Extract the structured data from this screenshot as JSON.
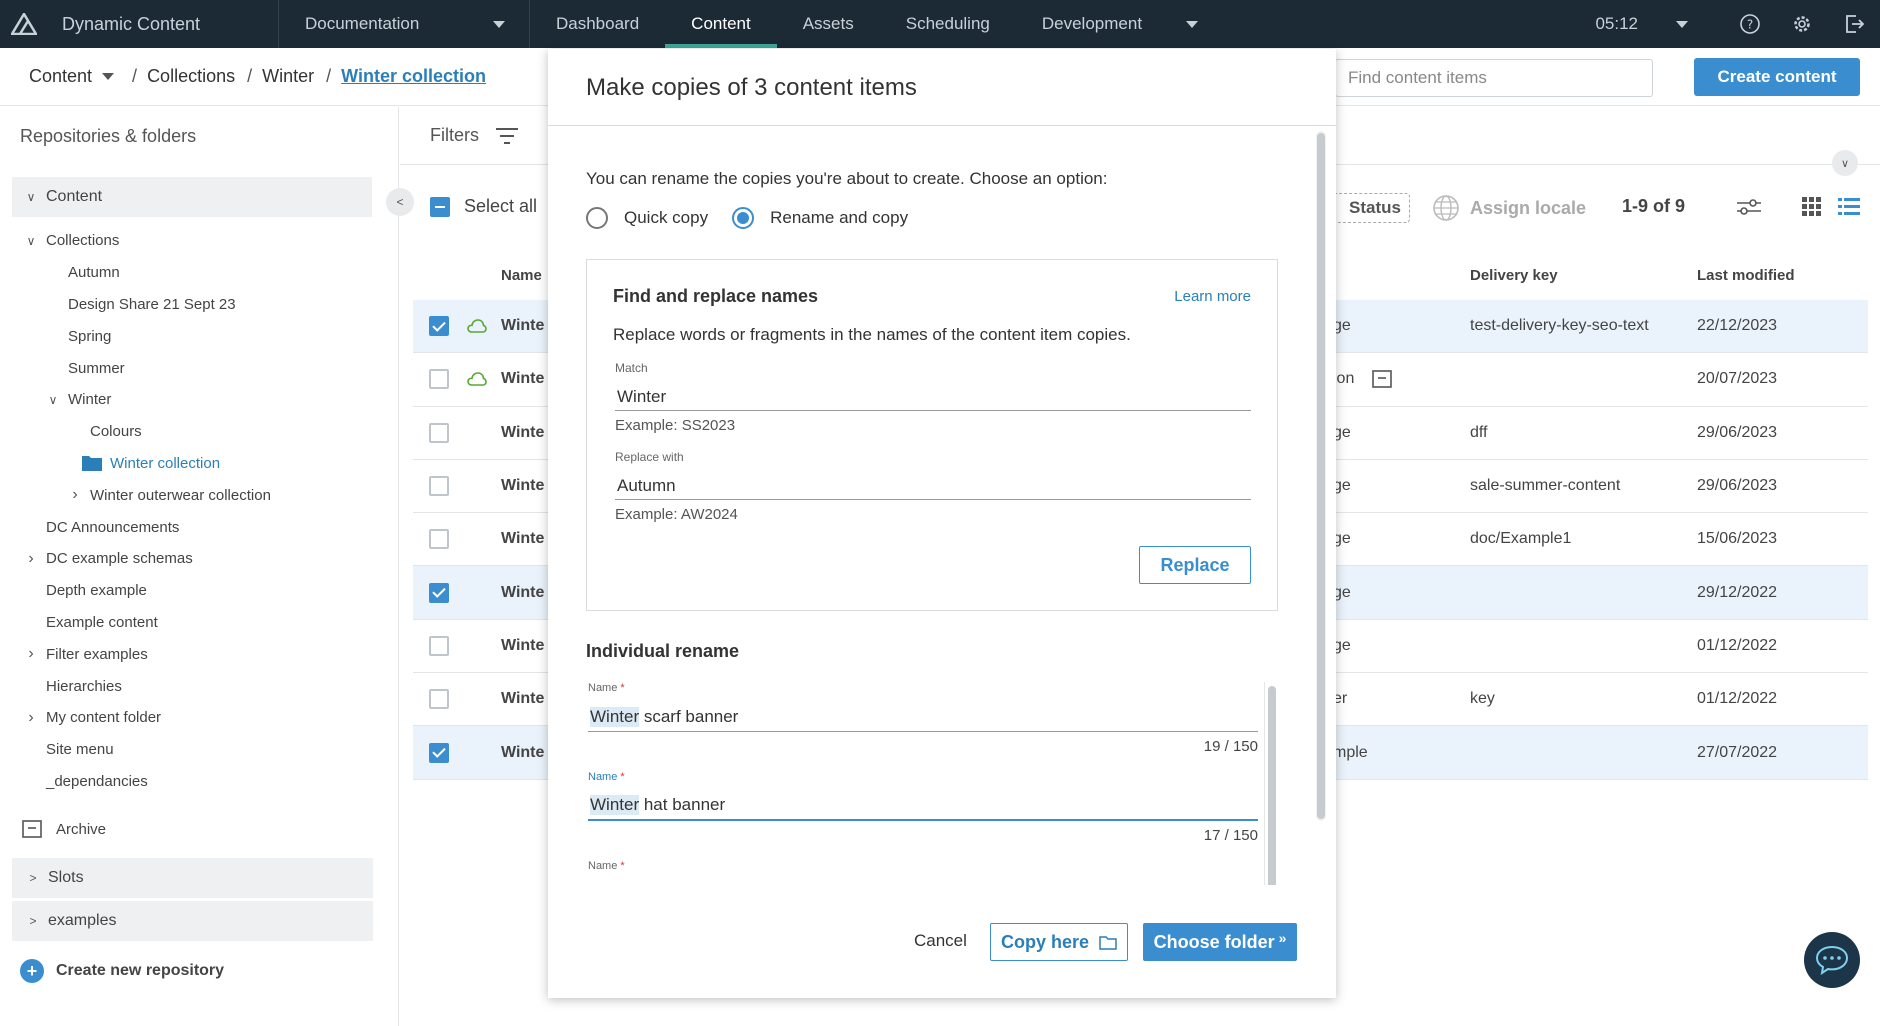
{
  "nav": {
    "app_title": "Dynamic Content",
    "hub": "Documentation",
    "tabs": [
      "Dashboard",
      "Content",
      "Assets",
      "Scheduling",
      "Development"
    ],
    "clock": "05:12"
  },
  "breadcrumb": {
    "root": "Content",
    "items": [
      "Collections",
      "Winter"
    ],
    "current": "Winter collection"
  },
  "search": {
    "placeholder": "Find content items"
  },
  "create_label": "Create content",
  "sidebar": {
    "title": "Repositories & folders",
    "root": "Content",
    "tree": [
      {
        "label": "Collections",
        "chev": "v"
      },
      {
        "label": "Autumn",
        "chev": ""
      },
      {
        "label": "Design Share 21 Sept 23",
        "chev": ""
      },
      {
        "label": "Spring",
        "chev": ""
      },
      {
        "label": "Summer",
        "chev": ""
      },
      {
        "label": "Winter",
        "chev": "v"
      },
      {
        "label": "Colours",
        "chev": ""
      },
      {
        "label": "Winter collection",
        "chev": ""
      },
      {
        "label": "Winter outerwear collection",
        "chev": ">"
      },
      {
        "label": "DC Announcements",
        "chev": ""
      },
      {
        "label": "DC example schemas",
        "chev": ">"
      },
      {
        "label": "Depth example",
        "chev": ""
      },
      {
        "label": "Example content",
        "chev": ""
      },
      {
        "label": "Filter examples",
        "chev": ">"
      },
      {
        "label": "Hierarchies",
        "chev": ""
      },
      {
        "label": "My content folder",
        "chev": ">"
      },
      {
        "label": "Site menu",
        "chev": ""
      },
      {
        "label": "_dependancies",
        "chev": ""
      }
    ],
    "archive": "Archive",
    "groups": [
      "Slots",
      "examples"
    ],
    "new_repo": "Create new repository"
  },
  "list": {
    "filters": "Filters",
    "select_all": "Select all",
    "status_chip": "Status",
    "assign_locale": "Assign locale",
    "pager": "1-9 of 9",
    "columns": {
      "name": "Name",
      "delivery_key": "Delivery key",
      "last_modified": "Last modified"
    },
    "rows": [
      {
        "checked": true,
        "cloud": true,
        "name": "Winte",
        "stat": "ge",
        "key": "test-delivery-key-seo-text",
        "date": "22/12/2023"
      },
      {
        "checked": false,
        "cloud": true,
        "name": "Winte",
        "stat": "ion",
        "key": "",
        "date": "20/07/2023"
      },
      {
        "checked": false,
        "cloud": false,
        "name": "Winte",
        "stat": "ge",
        "key": "dff",
        "date": "29/06/2023"
      },
      {
        "checked": false,
        "cloud": false,
        "name": "Winte",
        "stat": "ge",
        "key": "sale-summer-content",
        "date": "29/06/2023"
      },
      {
        "checked": false,
        "cloud": false,
        "name": "Winte",
        "stat": "ge",
        "key": "doc/Example1",
        "date": "15/06/2023"
      },
      {
        "checked": true,
        "cloud": false,
        "name": "Winte",
        "stat": "ge",
        "key": "",
        "date": "29/12/2022"
      },
      {
        "checked": false,
        "cloud": false,
        "name": "Winte",
        "stat": "ge",
        "key": "",
        "date": "01/12/2022"
      },
      {
        "checked": false,
        "cloud": false,
        "name": "Winte",
        "stat": "er",
        "key": "key",
        "date": "01/12/2022"
      },
      {
        "checked": true,
        "cloud": false,
        "name": "Winte",
        "stat": "mple",
        "key": "",
        "date": "27/07/2022"
      }
    ]
  },
  "dialog": {
    "title": "Make copies of 3 content items",
    "intro": "You can rename the copies you're about to create. Choose an option:",
    "option_quick": "Quick copy",
    "option_rename": "Rename and copy",
    "find_replace": {
      "title": "Find and replace names",
      "learn_more": "Learn more",
      "description": "Replace words or fragments in the names of the content item copies.",
      "match_label": "Match",
      "match_value": "Winter",
      "match_hint": "Example: SS2023",
      "replace_label": "Replace with",
      "replace_value": "Autumn",
      "replace_hint": "Example: AW2024",
      "replace_button": "Replace"
    },
    "individual": {
      "title": "Individual rename",
      "field_label": "Name",
      "required_mark": "*",
      "items": [
        {
          "highlight": "Winter",
          "rest": " scarf banner",
          "count": "19 / 150"
        },
        {
          "highlight": "Winter",
          "rest": " hat banner",
          "count": "17 / 150"
        }
      ]
    },
    "cancel": "Cancel",
    "copy_here": "Copy here",
    "choose_folder": "Choose folder"
  }
}
